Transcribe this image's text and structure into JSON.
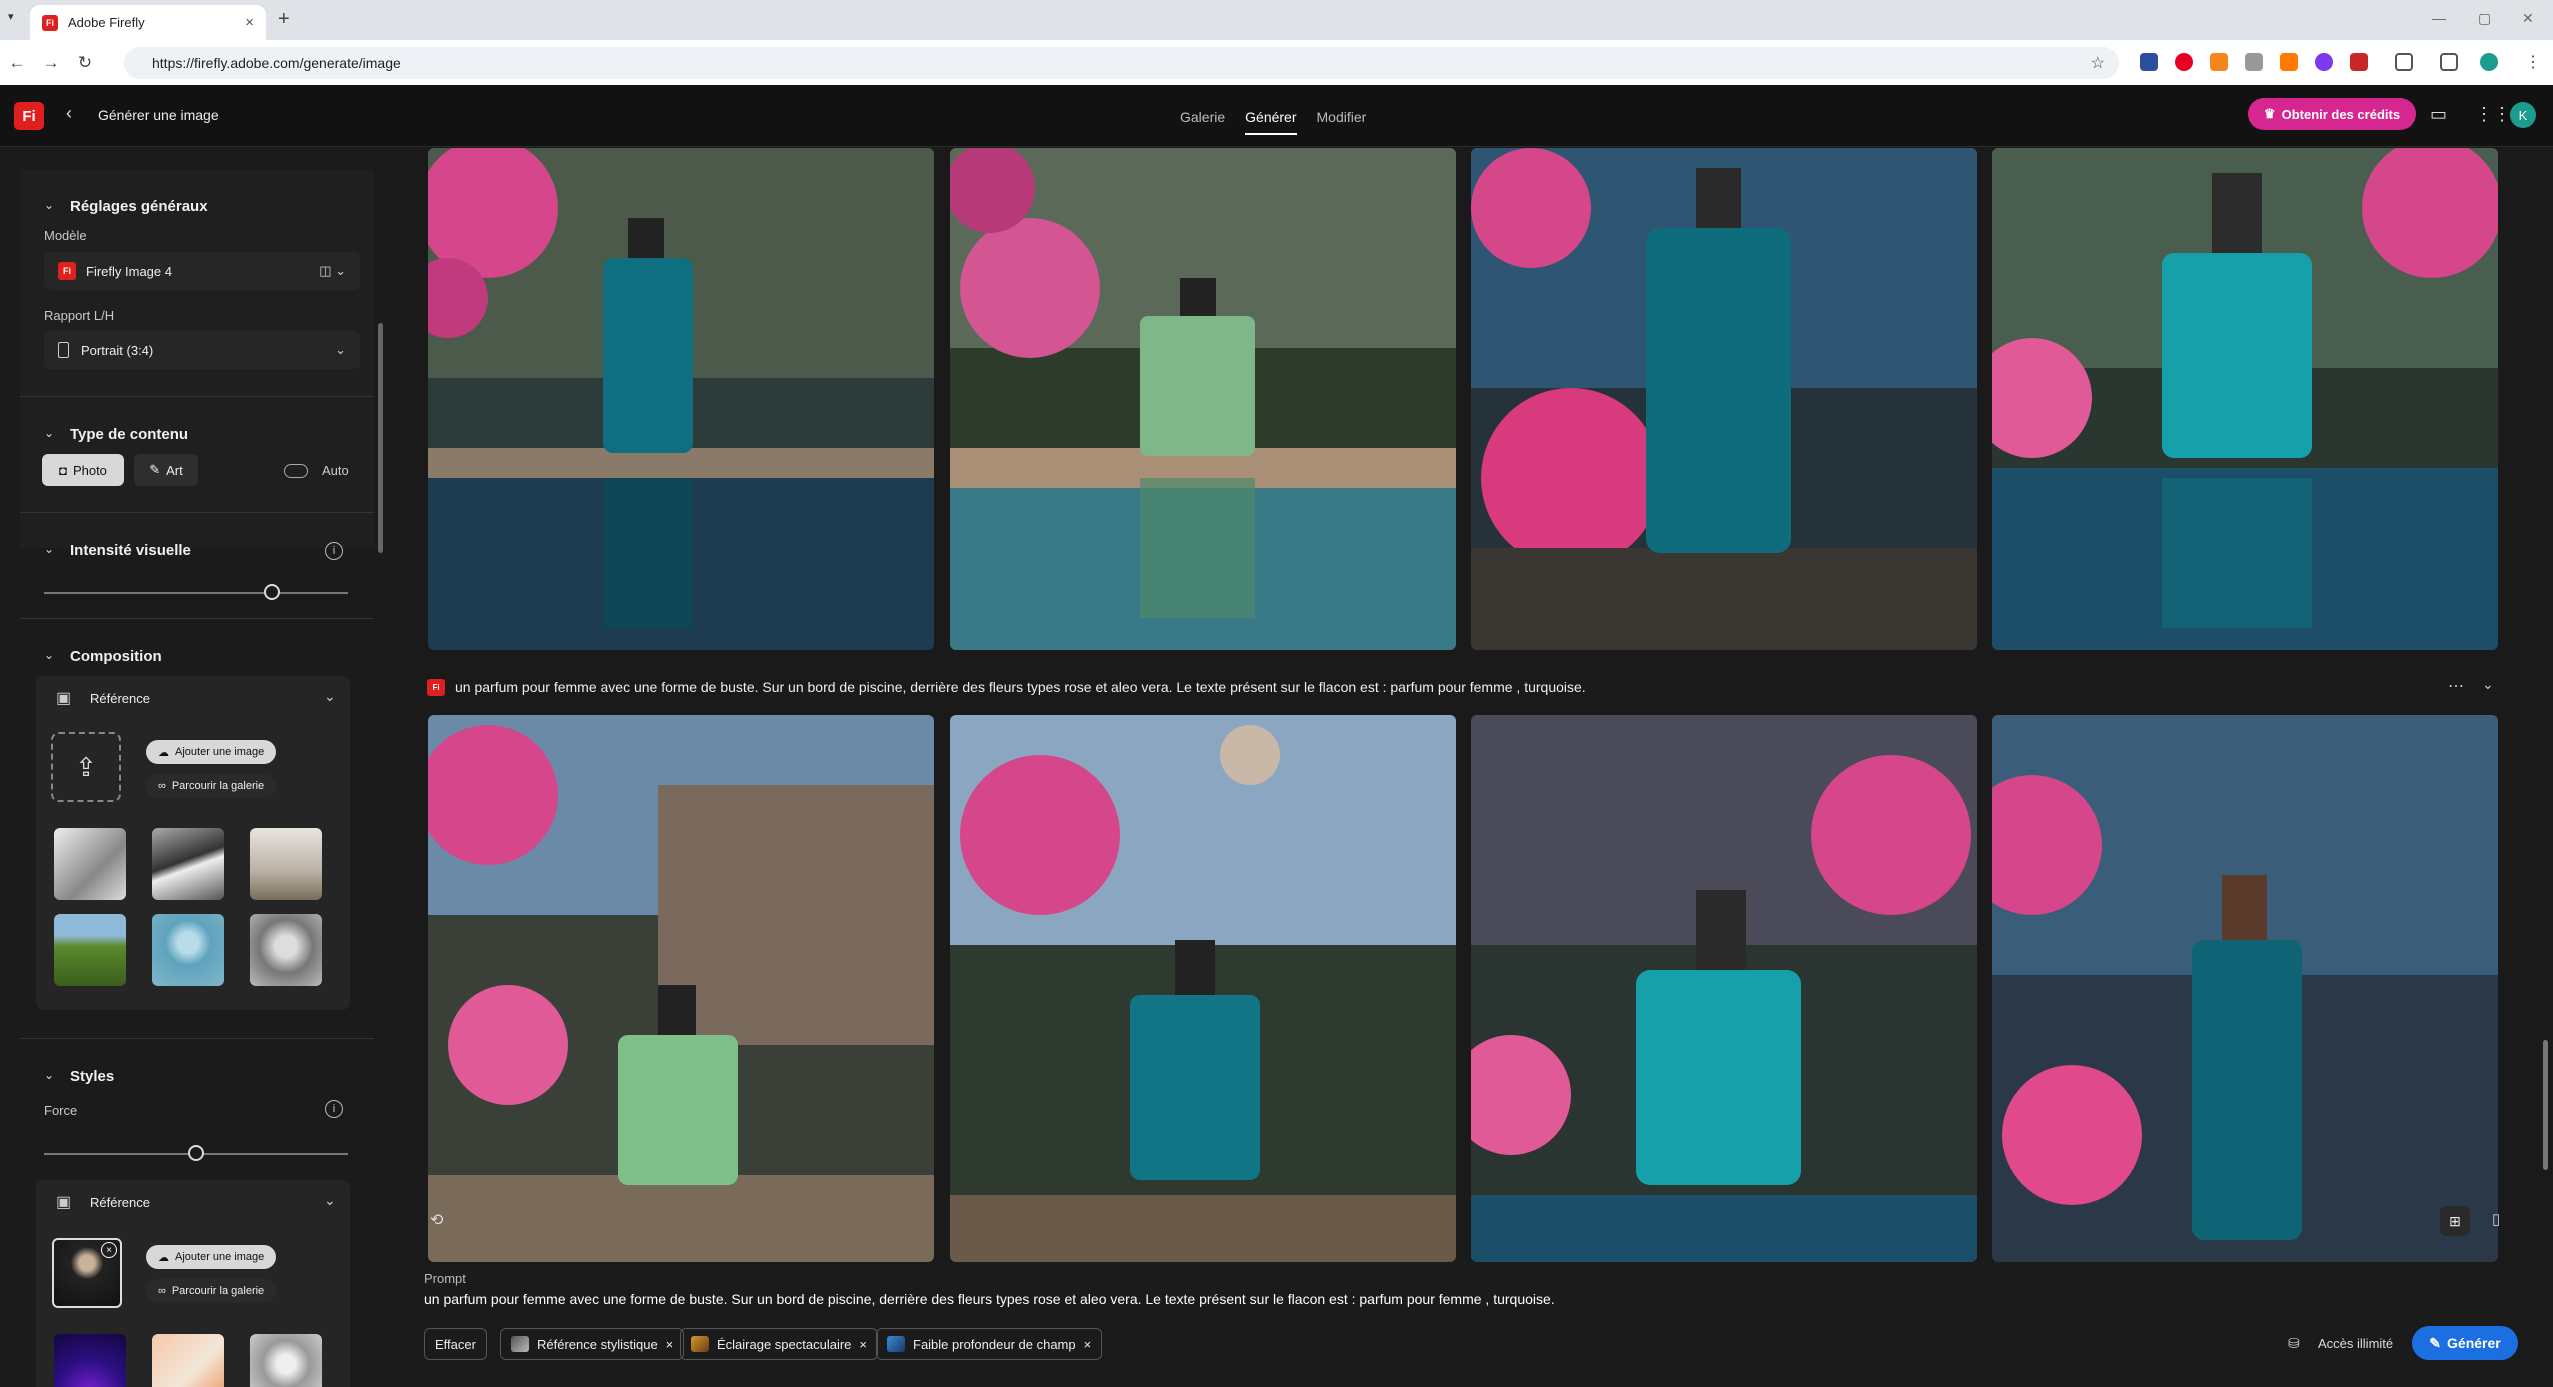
{
  "browser": {
    "tab_title": "Adobe Firefly",
    "url": "https://firefly.adobe.com/generate/image"
  },
  "app": {
    "logo": "Fi",
    "page_title": "Générer une image",
    "nav": [
      "Galerie",
      "Générer",
      "Modifier"
    ],
    "active_nav": "Générer",
    "credits_button": "Obtenir des crédits",
    "avatar_initial": "K"
  },
  "sidebar": {
    "general": {
      "title": "Réglages généraux",
      "model_label": "Modèle",
      "model_value": "Firefly Image 4",
      "ratio_label": "Rapport L/H",
      "ratio_value": "Portrait (3:4)"
    },
    "content_type": {
      "title": "Type de contenu",
      "photo": "Photo",
      "art": "Art",
      "auto": "Auto"
    },
    "visual_intensity": {
      "title": "Intensité visuelle",
      "level": 0.75
    },
    "composition": {
      "title": "Composition",
      "reference": "Référence",
      "add_image": "Ajouter une image",
      "browse_gallery": "Parcourir la galerie"
    },
    "styles": {
      "title": "Styles",
      "force_label": "Force",
      "force_level": 0.5,
      "reference": "Référence",
      "add_image": "Ajouter une image",
      "browse_gallery": "Parcourir la galerie"
    }
  },
  "main": {
    "prompt_text": "un parfum pour femme avec une forme de buste. Sur un bord de piscine, derrière des fleurs types rose et aleo vera. Le texte présent sur le flacon est : parfum pour femme , turquoise."
  },
  "prompt_panel": {
    "label": "Prompt",
    "text": "un parfum pour femme avec une forme de buste. Sur un bord de piscine, derrière des fleurs types rose et aleo vera. Le texte présent sur le flacon est : parfum pour femme , turquoise.",
    "clear_button": "Effacer",
    "chips": [
      "Référence stylistique",
      "Éclairage spectaculaire",
      "Faible profondeur de champ"
    ],
    "unlimited_access": "Accès illimité",
    "generate_button": "Générer"
  },
  "colors": {
    "accent_pink": "#d6268f",
    "generate_blue": "#1b6fe0",
    "brand_red": "#e0201f"
  }
}
